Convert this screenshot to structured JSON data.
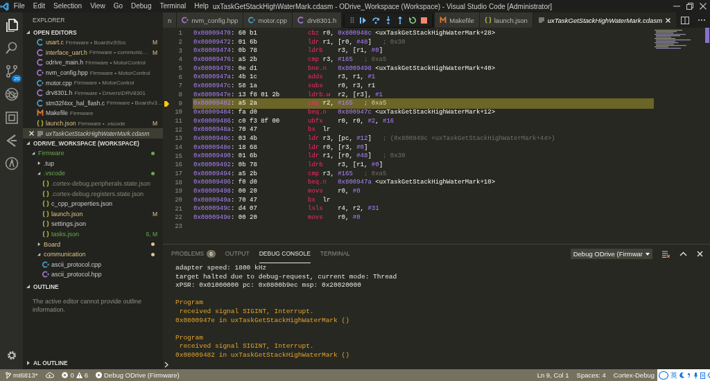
{
  "titlebar": {
    "menu": [
      "File",
      "Edit",
      "Selection",
      "View",
      "Go",
      "Debug",
      "Terminal",
      "Help"
    ],
    "title": "uxTaskGetStackHighWaterMark.cdasm - ODrive_Workspace (Workspace) - Visual Studio Code [Administrator]"
  },
  "activity": [
    {
      "kind": "explorer",
      "selected": true
    },
    {
      "kind": "search",
      "selected": false
    },
    {
      "kind": "scm",
      "selected": false,
      "badge": "20"
    },
    {
      "kind": "debug",
      "selected": false
    },
    {
      "kind": "extensions",
      "selected": false
    },
    {
      "kind": "chevron",
      "selected": false
    },
    {
      "kind": "circle",
      "selected": false
    }
  ],
  "sidebar": {
    "title": "EXPLORER",
    "open_editors": {
      "title": "OPEN EDITORS",
      "expanded": true,
      "items": [
        {
          "name": "usart.c",
          "desc": "Firmware • Board\\v3\\Src",
          "kind": "c",
          "badge": "M",
          "selected": false,
          "preview": false
        },
        {
          "name": "interface_uart.h",
          "desc": "Firmware • communic…",
          "kind": "h",
          "badge": "M",
          "selected": false,
          "preview": false
        },
        {
          "name": "odrive_main.h",
          "desc": "Firmware • MotorControl",
          "kind": "h",
          "selected": false,
          "preview": false
        },
        {
          "name": "nvm_config.hpp",
          "desc": "Firmware • MotorControl",
          "kind": "hpp",
          "selected": false,
          "preview": false
        },
        {
          "name": "motor.cpp",
          "desc": "Firmware • MotorControl",
          "kind": "cpp",
          "selected": false,
          "preview": false
        },
        {
          "name": "drv8301.h",
          "desc": "Firmware • Drivers\\DRV8301",
          "kind": "h",
          "selected": false,
          "preview": false
        },
        {
          "name": "stm32f4xx_hal_flash.c",
          "desc": "Firmware • Board\\v3…",
          "kind": "c",
          "selected": false,
          "preview": false
        },
        {
          "name": "Makefile",
          "desc": "Firmware",
          "kind": "make",
          "selected": false,
          "preview": false
        },
        {
          "name": "launch.json",
          "desc": "Firmware • .vscode",
          "kind": "json",
          "badge": "M",
          "selected": false,
          "preview": false
        },
        {
          "name": "uxTaskGetStackHighWaterMark.cdasm",
          "kind": "asm",
          "selected": true,
          "preview": true
        }
      ]
    },
    "workspace": {
      "title": "ODRIVE_WORKSPACE (WORKSPACE)",
      "expanded": true,
      "tree": [
        {
          "label": "Firmware",
          "kind": "folder",
          "expanded": true,
          "modified": false,
          "untracked": true,
          "ignored": false,
          "dot": true,
          "children": [
            {
              "label": ".tup",
              "kind": "folder",
              "expanded": false,
              "modified": false,
              "untracked": false,
              "ignored": false
            },
            {
              "label": ".vscode",
              "kind": "folder",
              "expanded": true,
              "modified": false,
              "untracked": true,
              "ignored": false,
              "dot": true,
              "children": [
                {
                  "label": ".cortex-debug.peripherals.state.json",
                  "kind": "json",
                  "modified": false,
                  "untracked": false,
                  "ignored": true
                },
                {
                  "label": ".cortex-debug.registers.state.json",
                  "kind": "json",
                  "modified": false,
                  "untracked": false,
                  "ignored": true
                },
                {
                  "label": "c_cpp_properties.json",
                  "kind": "json",
                  "modified": false,
                  "untracked": false,
                  "ignored": false
                },
                {
                  "label": "launch.json",
                  "kind": "json",
                  "modified": true,
                  "untracked": false,
                  "ignored": false,
                  "badge": "M"
                },
                {
                  "label": "settings.json",
                  "kind": "json",
                  "modified": false,
                  "untracked": false,
                  "ignored": false
                },
                {
                  "label": "tasks.json",
                  "kind": "json",
                  "modified": false,
                  "untracked": true,
                  "ignored": false,
                  "badge": "6, M"
                }
              ]
            },
            {
              "label": "Board",
              "kind": "folder",
              "expanded": false,
              "modified": true,
              "untracked": false,
              "ignored": false,
              "dot": true
            },
            {
              "label": "communication",
              "kind": "folder",
              "expanded": true,
              "modified": true,
              "untracked": false,
              "ignored": false,
              "dot": true,
              "children": [
                {
                  "label": "ascii_protocol.cpp",
                  "kind": "cpp",
                  "modified": false,
                  "untracked": false,
                  "ignored": false
                },
                {
                  "label": "ascii_protocol.hpp",
                  "kind": "hpp",
                  "modified": false,
                  "untracked": false,
                  "ignored": false
                }
              ]
            }
          ]
        }
      ]
    },
    "outline": {
      "title": "OUTLINE",
      "expanded": true,
      "message": "The active editor cannot provide outline information."
    },
    "al_outline": {
      "title": "AL OUTLINE",
      "expanded": false
    }
  },
  "tabs": [
    {
      "label": "n",
      "selected": false,
      "preview": false
    },
    {
      "label": "nvm_config.hpp",
      "kind": "hpp",
      "selected": false,
      "preview": false
    },
    {
      "label": "motor.cpp",
      "kind": "cpp",
      "selected": false,
      "preview": false
    },
    {
      "label": "drv8301.h",
      "kind": "h",
      "selected": false,
      "preview": false
    },
    {
      "label": "Makefile",
      "kind": "make",
      "selected": false,
      "preview": false
    },
    {
      "label": "launch.json",
      "kind": "json",
      "selected": false,
      "preview": false
    },
    {
      "label": "uxTaskGetStackHighWaterMark.cdasm",
      "kind": "asm",
      "selected": true,
      "preview": true
    }
  ],
  "code": {
    "lines": [
      {
        "num": "1",
        "code": "0x08009470: 60 b1",
        "instr": "cbz r0, 0x800948c <uxTaskGetStackHighWaterMark+28>",
        "current": false
      },
      {
        "num": "2",
        "code": "0x08009472: 01 6b",
        "instr": "ldr r1, [r0, #48]",
        "comment": "; 0x30",
        "current": false
      },
      {
        "num": "3",
        "code": "0x08009474: 0b 78",
        "instr": "ldrb    r3, [r1, #0]",
        "current": false
      },
      {
        "num": "4",
        "code": "0x08009476: a5 2b",
        "instr": "cmp r3, #165",
        "comment": "; 0xa5",
        "current": false
      },
      {
        "num": "5",
        "code": "0x08009478: 0e d1",
        "instr": "bne.n   0x8009498 <uxTaskGetStackHighWaterMark+40>",
        "current": false
      },
      {
        "num": "6",
        "code": "0x0800947a: 4b 1c",
        "instr": "adds    r3, r1, #1",
        "current": false
      },
      {
        "num": "7",
        "code": "0x0800947c: 58 1a",
        "instr": "subs    r0, r3, r1",
        "current": false
      },
      {
        "num": "8",
        "code": "0x0800947e: 13 f8 01 2b",
        "instr": "ldrb.w  r2, [r3], #1",
        "current": false
      },
      {
        "num": "9",
        "code": "0x08009482: a5 2a",
        "instr": "cmp r2, #165",
        "comment": "; 0xa5",
        "current": true
      },
      {
        "num": "10",
        "code": "0x08009484: fa d0",
        "instr": "beq.n   0x800947c <uxTaskGetStackHighWaterMark+12>",
        "current": false
      },
      {
        "num": "11",
        "code": "0x08009486: c0 f3 8f 00",
        "instr": "ubfx    r0, r0, #2, #16",
        "current": false
      },
      {
        "num": "12",
        "code": "0x0800948a: 70 47",
        "instr": "bx  lr",
        "current": false
      },
      {
        "num": "13",
        "code": "0x0800948c: 03 4b",
        "instr": "ldr r3, [pc, #12]",
        "comment": "; (0x800949c <uxTaskGetStackHighWaterMark+44>)",
        "current": false
      },
      {
        "num": "14",
        "code": "0x0800948e: 18 68",
        "instr": "ldr r0, [r3, #0]",
        "current": false
      },
      {
        "num": "15",
        "code": "0x08009490: 01 6b",
        "instr": "ldr r1, [r0, #48]",
        "comment": "; 0x30",
        "current": false
      },
      {
        "num": "16",
        "code": "0x08009492: 0b 78",
        "instr": "ldrb    r3, [r1, #0]",
        "current": false
      },
      {
        "num": "17",
        "code": "0x08009494: a5 2b",
        "instr": "cmp r3, #165",
        "comment": "; 0xa5",
        "current": false
      },
      {
        "num": "18",
        "code": "0x08009496: f0 d0",
        "instr": "beq.n   0x800947a <uxTaskGetStackHighWaterMark+10>",
        "current": false
      },
      {
        "num": "19",
        "code": "0x08009498: 00 20",
        "instr": "movs    r0, #0",
        "current": false
      },
      {
        "num": "20",
        "code": "0x0800949a: 70 47",
        "instr": "bx  lr",
        "current": false
      },
      {
        "num": "21",
        "code": "0x0800949c: d4 07",
        "instr": "lsls    r4, r2, #31",
        "current": false
      },
      {
        "num": "22",
        "code": "0x0800949e: 00 20",
        "instr": "movs    r0, #0",
        "current": false
      },
      {
        "num": "23",
        "current": false
      }
    ]
  },
  "panel": {
    "tabs": [
      {
        "label": "PROBLEMS",
        "badge": "6",
        "selected": false
      },
      {
        "label": "OUTPUT",
        "selected": false
      },
      {
        "label": "DEBUG CONSOLE",
        "selected": true
      },
      {
        "label": "TERMINAL",
        "selected": false
      }
    ],
    "launch_select": "Debug ODrive (Firmwar",
    "console": [
      {
        "kind": "info",
        "lines": [
          "adapter speed: 1800 kHz",
          "target halted due to debug-request, current mode: Thread",
          "xPSR: 0x01000000 pc: 0x0800b9ec msp: 0x20020000"
        ]
      },
      {
        "kind": "warn",
        "lines": [
          "Program",
          " received signal SIGINT, Interrupt.",
          "0x0800947e in uxTaskGetStackHighWaterMark ()"
        ]
      },
      {
        "kind": "warn",
        "lines": [
          "Program",
          " received signal SIGINT, Interrupt.",
          "0x08009482 in uxTaskGetStackHighWaterMark ()"
        ]
      }
    ]
  },
  "status": {
    "branch": "mt6813*",
    "errors": "0",
    "warnings": "6",
    "launch": "Debug ODrive (Firmware)",
    "position": "Ln 9, Col 1",
    "indent": "Spaces: 4",
    "mode": "Cortex-Debug"
  },
  "ime_toolbar": {
    "mode": "英"
  }
}
